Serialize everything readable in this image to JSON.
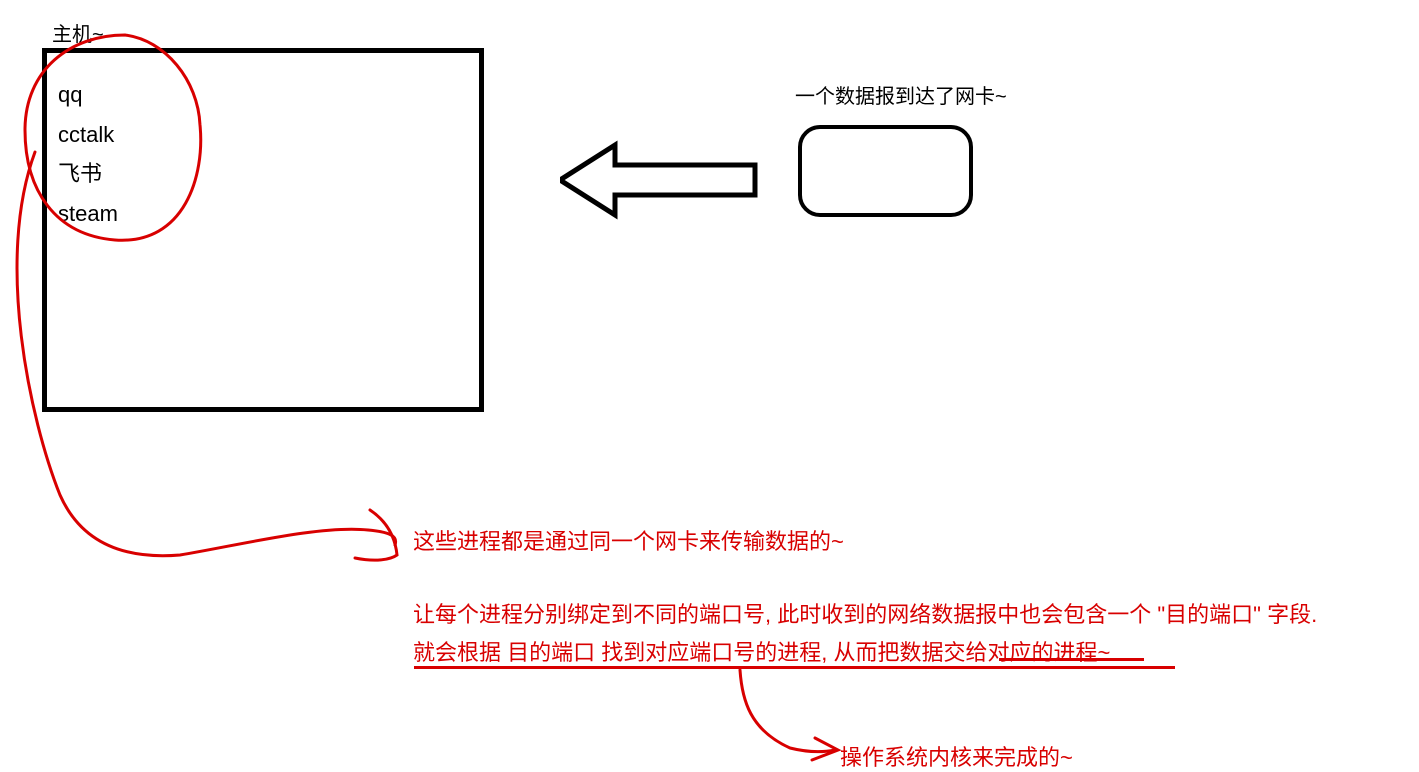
{
  "host": {
    "label": "主机~",
    "processes": [
      "qq",
      "cctalk",
      "飞书",
      "steam"
    ]
  },
  "netcard": {
    "label": "一个数据报到达了网卡~"
  },
  "annotations": {
    "line1": "这些进程都是通过同一个网卡来传输数据的~",
    "line2": "让每个进程分别绑定到不同的端口号, 此时收到的网络数据报中也会包含一个 \"目的端口\" 字段.",
    "line3": "就会根据 目的端口 找到对应端口号的进程, 从而把数据交给对应的进程~",
    "line4": "操作系统内核来完成的~"
  }
}
